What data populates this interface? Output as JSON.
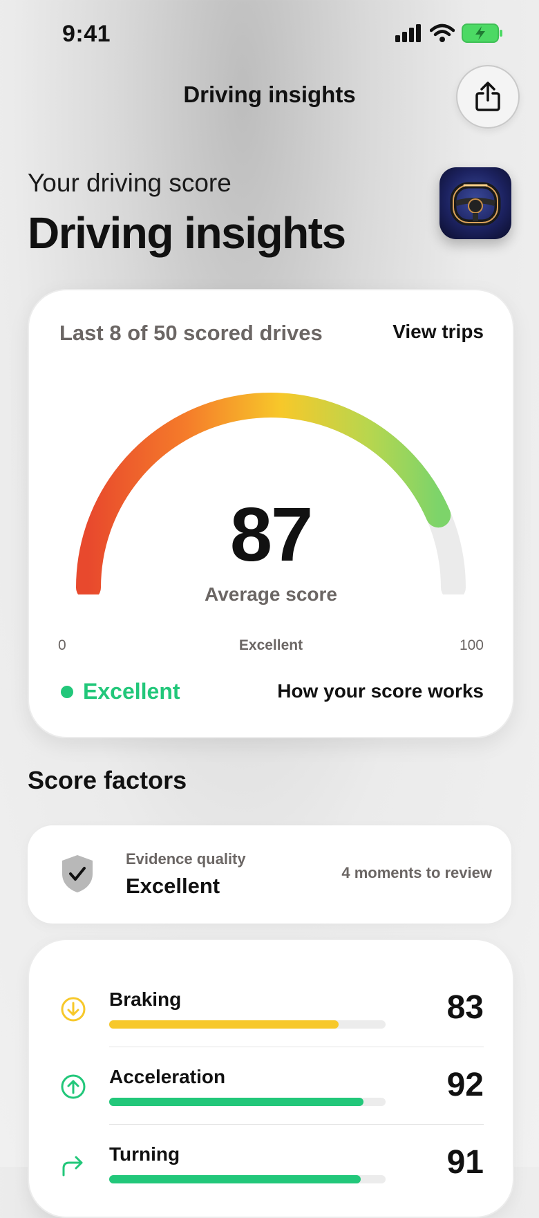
{
  "status_bar": {
    "time": "9:41"
  },
  "nav": {
    "title": "Driving insights",
    "share_icon": "share-icon"
  },
  "header": {
    "subtitle": "Your driving score",
    "title": "Driving insights",
    "app_icon": "steering-wheel-icon"
  },
  "score_card": {
    "caption": "Last 8 of 50 scored drives",
    "view_trips": "View trips",
    "score": "87",
    "score_label": "Average score",
    "gauge_fraction": 0.87,
    "tick_min": "0",
    "tick_mid": "Excellent",
    "tick_max": "100",
    "status": "Excellent",
    "how_link": "How your score works",
    "colors": {
      "red": "#e8492d",
      "orange": "#f57c2a",
      "yellow": "#f7c82a",
      "green": "#7dd46a",
      "status": "#22c77a"
    }
  },
  "factors": {
    "section_title": "Score factors",
    "evidence": {
      "label": "Evidence quality",
      "value": "Excellent",
      "moments": "4 moments to review",
      "icon": "shield-check-icon"
    },
    "items": [
      {
        "name": "Braking",
        "score": "83",
        "fraction": 0.83,
        "color": "#f7c82a",
        "icon": "arrow-down-circle-icon"
      },
      {
        "name": "Acceleration",
        "score": "92",
        "fraction": 0.92,
        "color": "#22c77a",
        "icon": "arrow-up-circle-icon"
      },
      {
        "name": "Turning",
        "score": "91",
        "fraction": 0.91,
        "color": "#22c77a",
        "icon": "turn-right-arrow-icon"
      }
    ]
  }
}
